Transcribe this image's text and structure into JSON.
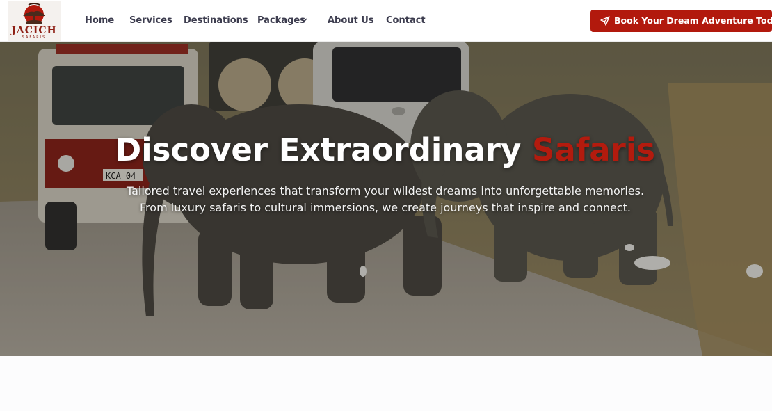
{
  "brand": {
    "name": "JACICH",
    "tagline": "SAFARIS",
    "accent_color": "#b2190d",
    "logo_icon": "tree-sunset-logo-icon"
  },
  "nav": {
    "items": [
      {
        "label": "Home"
      },
      {
        "label": "Services"
      },
      {
        "label": "Destinations"
      },
      {
        "label": "Packages",
        "has_dropdown": true
      },
      {
        "label": "About Us"
      },
      {
        "label": "Contact"
      }
    ],
    "dropdown_icon": "chevron-down-icon"
  },
  "cta": {
    "label": "Book Your Dream Adventure Today",
    "icon": "paper-plane-icon"
  },
  "hero": {
    "title_main": "Discover Extraordinary",
    "title_accent": "Safaris",
    "subtitle_line1": "Tailored travel experiences that transform your wildest dreams into unforgettable memories.",
    "subtitle_line2": "From luxury safaris to cultural immersions, we create journeys that inspire and connect.",
    "background": "elephants crossing a dirt road beside safari vehicles",
    "vehicle_plate": "KCA 04"
  }
}
